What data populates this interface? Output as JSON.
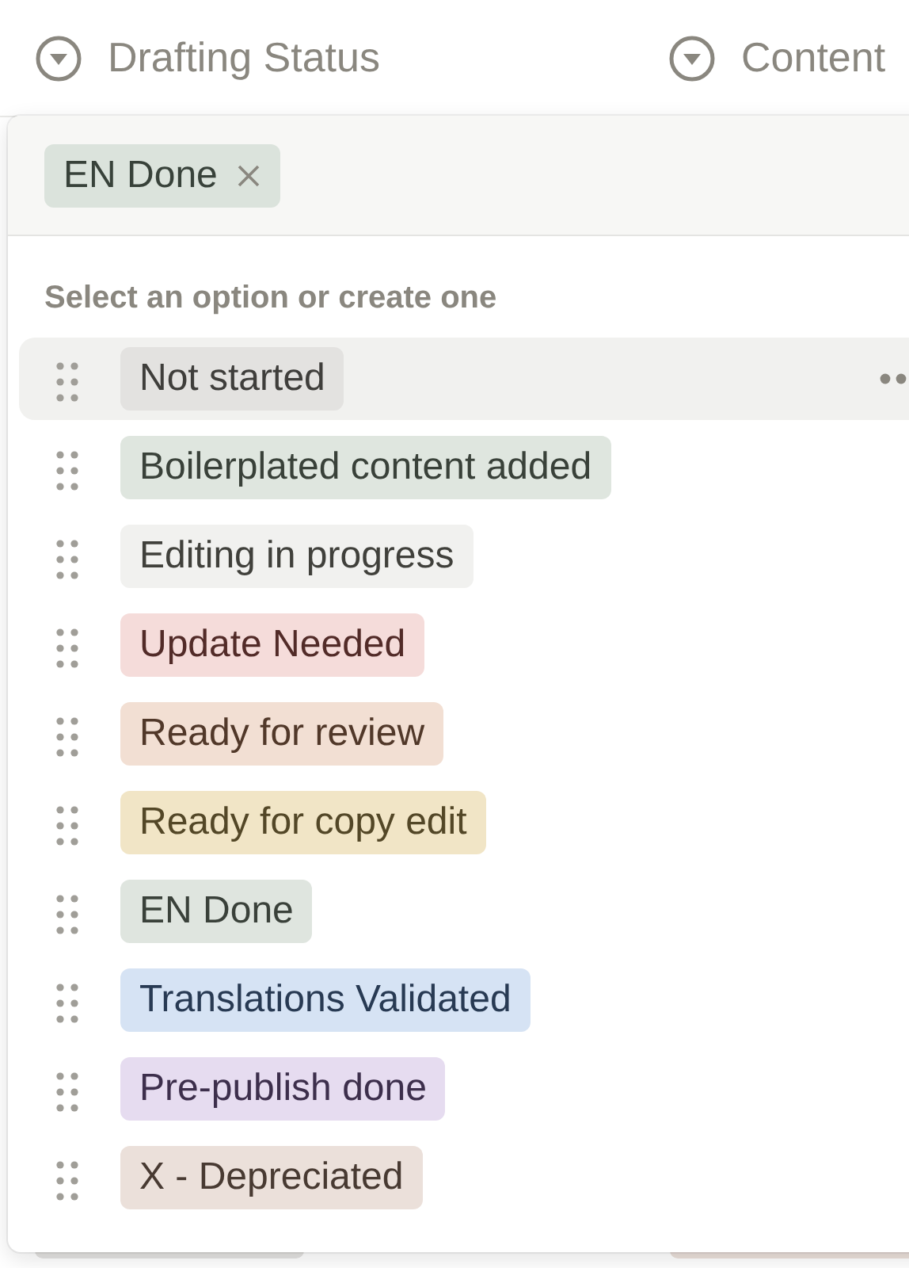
{
  "columns": [
    {
      "title": "Drafting Status"
    },
    {
      "title": "Content"
    }
  ],
  "popup": {
    "selected_tags": [
      {
        "label": "EN Done",
        "color": "#dbe3dc"
      }
    ],
    "hint": "Select an option or create one",
    "options": [
      {
        "label": "Not started",
        "color": "#e3e2e0",
        "highlighted": true
      },
      {
        "label": "Boilerplated content added",
        "color": "#dfe6df",
        "highlighted": false
      },
      {
        "label": "Editing in progress",
        "color": "#f1f1ef",
        "highlighted": false
      },
      {
        "label": "Update Needed",
        "color": "#f5dcda",
        "highlighted": false
      },
      {
        "label": "Ready for review",
        "color": "#f2dfd3",
        "highlighted": false
      },
      {
        "label": "Ready for copy edit",
        "color": "#f1e5c6",
        "highlighted": false
      },
      {
        "label": "EN Done",
        "color": "#dfe5df",
        "highlighted": false
      },
      {
        "label": "Translations Validated",
        "color": "#d6e3f4",
        "highlighted": false
      },
      {
        "label": "Pre-publish done",
        "color": "#e6dcf0",
        "highlighted": false
      },
      {
        "label": "X - Depreciated",
        "color": "#ebe0da",
        "highlighted": false
      }
    ]
  }
}
